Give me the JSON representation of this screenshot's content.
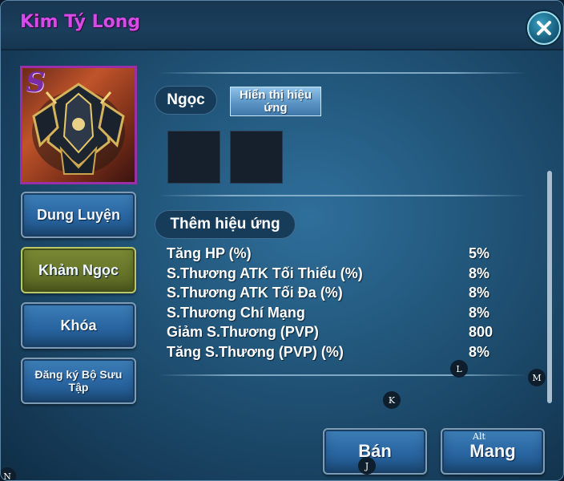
{
  "window": {
    "title": "Kim Tý Long",
    "close_icon": "close-x-icon",
    "accent_title_color": "#d64be6"
  },
  "item": {
    "rank": "S",
    "rank_color": "#7a2ba6",
    "frame_color": "#9b2fa8",
    "image_icon": "armor-icon"
  },
  "side_menu": [
    {
      "label": "Dung Luyện",
      "active": false
    },
    {
      "label": "Khảm Ngọc",
      "active": true
    },
    {
      "label": "Khóa",
      "active": false
    },
    {
      "label": "Đăng ký Bộ Sưu Tập",
      "active": false
    }
  ],
  "gem_section": {
    "label": "Ngọc",
    "show_effect_button": "Hiển thị hiệu ứng",
    "slots": [
      {
        "filled": false
      },
      {
        "filled": false
      }
    ]
  },
  "effects_section": {
    "label": "Thêm hiệu ứng",
    "stats": [
      {
        "name": "Tăng HP (%)",
        "value": "5%"
      },
      {
        "name": "S.Thương ATK Tối Thiểu (%)",
        "value": "8%"
      },
      {
        "name": "S.Thương ATK Tối Đa (%)",
        "value": "8%"
      },
      {
        "name": "S.Thương Chí Mạng",
        "value": "8%"
      },
      {
        "name": "Giảm S.Thương (PVP)",
        "value": "800"
      },
      {
        "name": "Tăng S.Thương (PVP) (%)",
        "value": "8%"
      }
    ]
  },
  "actions": {
    "sell": "Bán",
    "equip": "Mang"
  },
  "key_hints": {
    "l": "L",
    "m": "M",
    "k": "K",
    "alt": "Alt",
    "j": "J",
    "n": "N"
  }
}
